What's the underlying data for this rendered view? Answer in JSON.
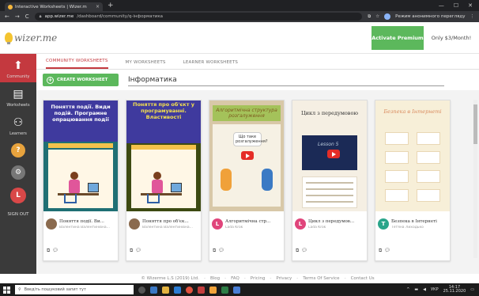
{
  "browser": {
    "tab_title": "Interactive Worksheets | Wizer.m",
    "tab_close": "×",
    "new_tab": "+",
    "url_host": "app.wizer.me",
    "url_path": "/dashboard/community/q-інформатика",
    "translate_label": "Режим анонимного перегляду"
  },
  "header": {
    "logo_text": "wizer.me",
    "premium_button": "Activate Premium",
    "price_text": "Only $3/Month!"
  },
  "sidebar": {
    "items": [
      {
        "label": "Community"
      },
      {
        "label": "Worksheets"
      },
      {
        "label": "Learners"
      }
    ],
    "help_glyph": "?",
    "user_initial": "L",
    "signout": "SIGN OUT"
  },
  "nav": {
    "tabs": [
      "COMMUNITY WORKSHEETS",
      "MY WORKSHEETS",
      "LEARNER WORKSHEETS"
    ],
    "active_tab": 0
  },
  "toolbar": {
    "create_label": "CREATE WORKSHEET",
    "plus": "+",
    "search_value": "Інформатика"
  },
  "cards": [
    {
      "thumb_text": "Поняття події. Види подій. Програмне опрацювання події",
      "title": "Поняття події. Ви...",
      "author": "Валентина Валентинівна...",
      "avatar_color": "#8a6a4e",
      "avatar_initial": ""
    },
    {
      "thumb_text": "Поняття про об'єкт у програмуванні. Властивості",
      "title": "Поняття про об'єк...",
      "author": "Валентина Валентинівна...",
      "avatar_color": "#8a6a4e",
      "avatar_initial": ""
    },
    {
      "thumb_text": "Алгоритмічна структура розгалуження",
      "title": "Алгоритмічна стр...",
      "author": "Lada Krok",
      "avatar_color": "#e0457b",
      "avatar_initial": "L",
      "bubble": "Що таке розгалуження?"
    },
    {
      "thumb_text": "Цикл з передумовою",
      "title": "Цикл з передумов...",
      "author": "Lada Krok",
      "avatar_color": "#e0457b",
      "avatar_initial": "L",
      "video_label": "Lesson 5"
    },
    {
      "thumb_text": "Безпека в Інтернеті",
      "title": "Безпека в Інтернеті",
      "author": "Тетяна Лиходько",
      "avatar_color": "#2aa58a",
      "avatar_initial": "T"
    }
  ],
  "footer": {
    "copyright": "© Wizerme L.S (2019) Ltd.",
    "links": [
      "Blog",
      "FAQ",
      "Pricing",
      "Privacy",
      "Terms Of Service",
      "Contact Us"
    ]
  },
  "taskbar": {
    "search_placeholder": "Введіть пошуковий запит тут",
    "lang": "УКР",
    "time": "14:17",
    "date": "25.11.2020"
  },
  "colors": {
    "accent_red": "#c4393f",
    "green": "#5cb85c",
    "sidebar_bg": "#3a3a3a"
  }
}
